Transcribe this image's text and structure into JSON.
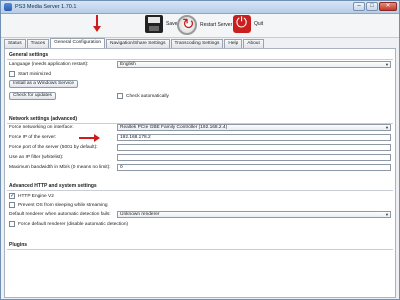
{
  "window": {
    "title": "PS3 Media Server 1.70.1"
  },
  "toolbar": {
    "save_label": "Save",
    "restart_label": "Restart Server",
    "quit_label": "Quit"
  },
  "tabs": [
    {
      "label": "Status"
    },
    {
      "label": "Traces"
    },
    {
      "label": "General Configuration"
    },
    {
      "label": "Navigation/Share Settings"
    },
    {
      "label": "Transcoding Settings"
    },
    {
      "label": "Help"
    },
    {
      "label": "About"
    }
  ],
  "general": {
    "title": "General settings",
    "language_label": "Language (needs application restart):",
    "language_value": "English",
    "start_minimized": "Start minimized",
    "install_service": "Install as a Windows Service",
    "check_updates": "Check for updates",
    "check_auto": "Check automatically"
  },
  "network": {
    "title": "Network settings (advanced)",
    "force_iface_label": "Force networking on interface:",
    "force_iface_value": "Realtek PCIe GBE Family Controller (192.168.2.4)",
    "force_ip_label": "Force IP of the server:",
    "force_ip_value": "192.168.178.2",
    "force_port_label": "Force port of the server (5001 by default):",
    "force_port_value": "",
    "ip_filter_label": "Use an IP filter (whitelist):",
    "ip_filter_value": "",
    "max_bw_label": "Maximum bandwidth in Mb/s (0 means no limit):",
    "max_bw_value": "0"
  },
  "advanced": {
    "title": "Advanced HTTP and system settings",
    "http_engine": "HTTP Engine V2",
    "prevent_sleep": "Prevent OS from sleeping while streaming",
    "default_renderer_label": "Default renderer when automatic detection fails:",
    "default_renderer_value": "Unknown renderer",
    "force_default_renderer": "Force default renderer (disable automatic detection)"
  },
  "plugins": {
    "title": "Plugins"
  },
  "colors": {
    "accent": "#cf1b1b",
    "title_bar": "#c8daf0"
  }
}
